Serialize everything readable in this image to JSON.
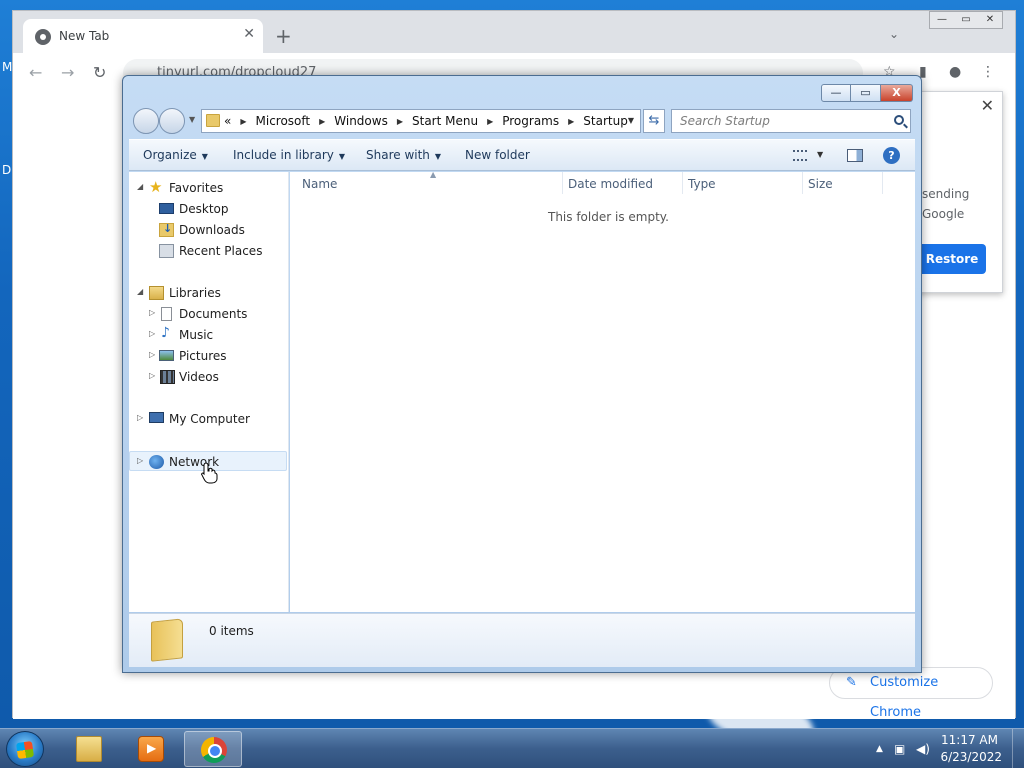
{
  "desktop": {
    "left_letters": [
      "M",
      "D"
    ]
  },
  "chrome": {
    "tab_title": "New Tab",
    "tab_close": "✕",
    "new_tab": "+",
    "tab_menu": "⌄",
    "url": "tinyurl.com/dropcloud27",
    "back": "←",
    "forward": "→",
    "reload": "↻",
    "win_min": "—",
    "win_max": "▭",
    "win_close": "✕",
    "popup": {
      "close": "✕",
      "line1": "sending",
      "line2": "Google",
      "restore_label": "Restore"
    },
    "customize_label": "Customize Chrome",
    "accent": "#1a73e8"
  },
  "explorer": {
    "cap_close": "X",
    "breadcrumb": [
      "«",
      "Microsoft",
      "Windows",
      "Start Menu",
      "Programs",
      "Startup"
    ],
    "search_placeholder": "Search Startup",
    "commands": {
      "organize": "Organize",
      "include": "Include in library",
      "share": "Share with",
      "new_folder": "New folder"
    },
    "help": "?",
    "nav": {
      "favorites": "Favorites",
      "desktop": "Desktop",
      "downloads": "Downloads",
      "recent": "Recent Places",
      "libraries": "Libraries",
      "documents": "Documents",
      "music": "Music",
      "pictures": "Pictures",
      "videos": "Videos",
      "computer": "My Computer",
      "network": "Network"
    },
    "columns": [
      "Name",
      "Date modified",
      "Type",
      "Size"
    ],
    "empty_message": "This folder is empty.",
    "item_count": "0 items"
  },
  "taskbar": {
    "time": "11:17 AM",
    "date": "6/23/2022"
  }
}
